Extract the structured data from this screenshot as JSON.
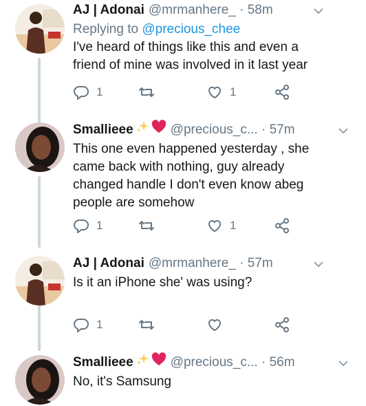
{
  "tweets": [
    {
      "name": "AJ | Adonai",
      "handle": "@mrmanhere_",
      "time": "58m",
      "replying_label": "Replying to",
      "replying_to": "@precious_chee",
      "lines": [
        "I've heard of things like this and even a",
        "friend of mine was involved in it last year"
      ],
      "reply_count": "1",
      "like_count": "1"
    },
    {
      "name": "Smallieee",
      "handle": "@precious_c...",
      "time": "57m",
      "lines": [
        "This one even happened yesterday , she",
        "came back with nothing, guy already",
        "changed handle I don't even know abeg",
        "people are  somehow"
      ],
      "reply_count": "1",
      "like_count": "1"
    },
    {
      "name": "AJ | Adonai",
      "handle": "@mrmanhere_",
      "time": "57m",
      "lines": [
        "Is it an iPhone she' was using?"
      ],
      "reply_count": "1",
      "like_count": ""
    },
    {
      "name": "Smallieee",
      "handle": "@precious_c...",
      "time": "56m",
      "lines": [
        "No, it's Samsung"
      ]
    }
  ],
  "icons": [
    "reply-icon",
    "retweet-icon",
    "like-icon",
    "share-icon",
    "caret-down-icon",
    "sparkles-emoji",
    "red-heart-emoji"
  ],
  "colors": {
    "secondary_text": "#657786",
    "link": "#1b95e0",
    "heart_emoji": "#e0245e",
    "sparkle_emoji": "#ffcc4d",
    "thread_line": "#ccd6dd"
  }
}
